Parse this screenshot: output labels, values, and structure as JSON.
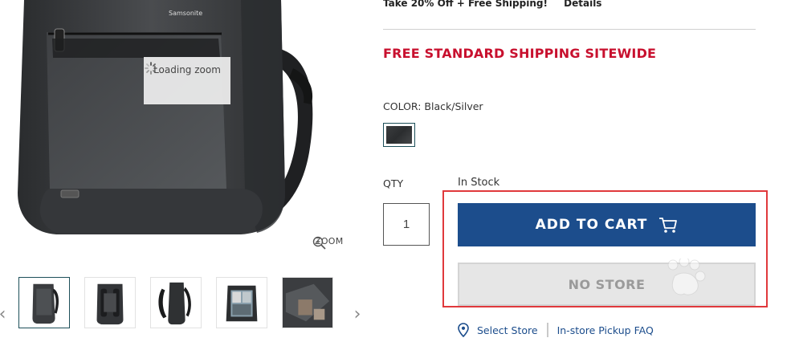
{
  "product_image": {
    "brand_text": "Samsonite",
    "loading_text": "Loading zoom",
    "zoom_label": "ZOOM"
  },
  "thumbnails": {
    "prev_arrow": "‹",
    "next_arrow": "›",
    "items": [
      {
        "label": "front view",
        "active": true
      },
      {
        "label": "back view",
        "active": false
      },
      {
        "label": "side view",
        "active": false
      },
      {
        "label": "open interior view",
        "active": false
      },
      {
        "label": "detail view",
        "active": false
      }
    ]
  },
  "promo": {
    "text": "Take 20% Off + Free Shipping!",
    "details_link": "Details"
  },
  "shipping_banner": "FREE STANDARD SHIPPING SITEWIDE",
  "color": {
    "label": "COLOR: Black/Silver",
    "swatch_color": "#2f3133"
  },
  "qty": {
    "label": "QTY",
    "value": "1"
  },
  "stock_status": "In Stock",
  "buttons": {
    "add_to_cart": "ADD TO CART",
    "no_store": "NO STORE"
  },
  "store_links": {
    "select_store": "Select Store",
    "pickup_faq": "In-store Pickup FAQ"
  },
  "colors": {
    "accent_blue": "#1c4d8c",
    "promo_red": "#c8102e",
    "highlight_red": "#e0393c"
  }
}
